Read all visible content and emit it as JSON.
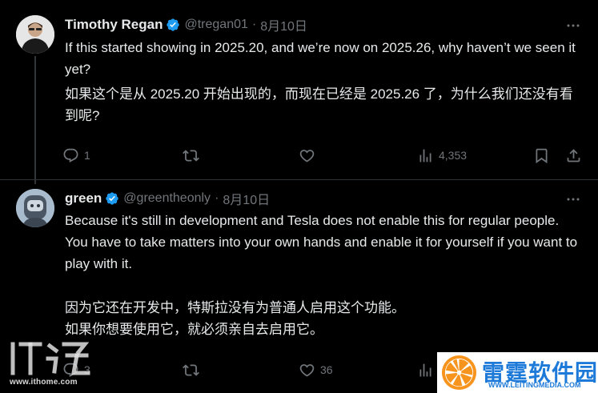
{
  "tweets": [
    {
      "name": "Timothy Regan",
      "handle": "@tregan01",
      "separator": "·",
      "date": "8月10日",
      "text_en": "If this started showing in 2025.20, and we’re now on 2025.26, why haven’t we seen it yet?",
      "text_zh": "如果这个是从 2025.20 开始出现的，而现在已经是 2025.26 了，为什么我们还没有看到呢?",
      "replies": "1",
      "retweets": "",
      "likes": "",
      "views": "4,353"
    },
    {
      "name": "green",
      "handle": "@greentheonly",
      "separator": "·",
      "date": "8月10日",
      "text_en": "Because it's still in development and Tesla does not enable this for regular people.\nYou have to take matters into your own hands and enable it for yourself if you want to play with it.",
      "text_zh": "因为它还在开发中，特斯拉没有为普通人启用这个功能。\n如果你想要使用它，就必须亲自去启用它。",
      "replies": "3",
      "retweets": "",
      "likes": "36",
      "views": ""
    }
  ],
  "icons": {
    "verified": "verified-badge-icon",
    "more": "more-horizontal-icon",
    "reply": "reply-icon",
    "retweet": "retweet-icon",
    "like": "heart-icon",
    "views": "views-chart-icon",
    "bookmark": "bookmark-icon",
    "share": "share-icon"
  },
  "colors": {
    "background": "#000000",
    "text": "#e7e9ea",
    "muted": "#71767b",
    "verified": "#1d9bf0",
    "divider": "#2f3336"
  },
  "watermarks": {
    "ithome_logo": "IT之家",
    "ithome_url": "www.ithome.com",
    "leiting_name": "雷霆软件园",
    "leiting_url": "WWW.LEITINGMEDIA.COM"
  }
}
